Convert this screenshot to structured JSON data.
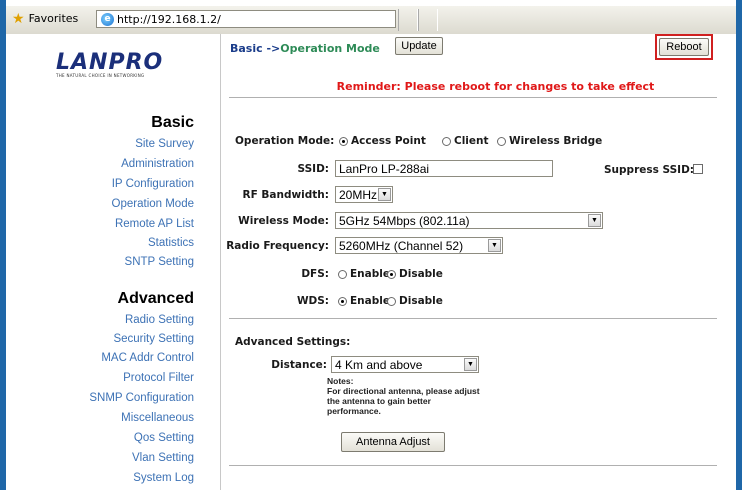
{
  "browser": {
    "favorites_label": "Favorites",
    "address": "http://192.168.1.2/"
  },
  "brand": {
    "logo_text": "LANPRO",
    "tagline": "THE NATURAL CHOICE IN NETWORKING"
  },
  "sidebar": {
    "basic_heading": "Basic",
    "basic_items": [
      "Site Survey",
      "Administration",
      "IP Configuration",
      "Operation Mode",
      "Remote AP List",
      "Statistics",
      "SNTP Setting"
    ],
    "advanced_heading": "Advanced",
    "advanced_items": [
      "Radio Setting",
      "Security Setting",
      "MAC Addr Control",
      "Protocol Filter",
      "SNMP Configuration",
      "Miscellaneous",
      "Qos Setting",
      "Vlan Setting",
      "System Log"
    ]
  },
  "main": {
    "breadcrumb_prefix": "Basic ->",
    "breadcrumb_current": "Operation Mode",
    "update_button": "Update",
    "reboot_button": "Reboot",
    "reminder": "Reminder: Please reboot for changes to take effect",
    "operation_mode": {
      "label": "Operation Mode:",
      "options": [
        "Access Point",
        "Client",
        "Wireless Bridge"
      ],
      "selected": "Access Point"
    },
    "ssid": {
      "label": "SSID:",
      "value": "LanPro LP-288ai"
    },
    "suppress_ssid": {
      "label": "Suppress SSID:",
      "checked": false
    },
    "rf_bandwidth": {
      "label": "RF Bandwidth:",
      "value": "20MHz"
    },
    "wireless_mode": {
      "label": "Wireless Mode:",
      "value": "5GHz 54Mbps (802.11a)"
    },
    "radio_frequency": {
      "label": "Radio Frequency:",
      "value": "5260MHz (Channel 52)"
    },
    "dfs": {
      "label": "DFS:",
      "options": [
        "Enable",
        "Disable"
      ],
      "selected": "Disable"
    },
    "wds": {
      "label": "WDS:",
      "options": [
        "Enable",
        "Disable"
      ],
      "selected": "Enable"
    },
    "advanced_settings": {
      "heading": "Advanced Settings:",
      "distance_label": "Distance:",
      "distance_value": "4 Km and above",
      "notes": [
        "Notes:",
        "For directional antenna, please adjust",
        "the antenna to gain better",
        "performance."
      ],
      "antenna_button": "Antenna Adjust"
    }
  },
  "colors": {
    "frame_blue": "#1f67a8",
    "nav_link": "#3d72b5",
    "breadcrumb": "#1a3c8a",
    "breadcrumb_current": "#2e8b57",
    "reminder_red": "#e01818",
    "highlight_red": "#d02020"
  }
}
